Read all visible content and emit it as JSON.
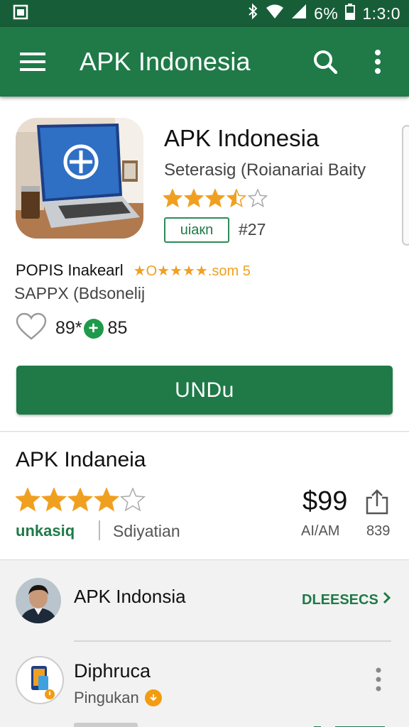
{
  "status_bar": {
    "battery": "6%",
    "time": "1:3:0"
  },
  "app_bar": {
    "title": "APK Indonesia",
    "icons": [
      "menu-icon",
      "search-icon",
      "more-vert-icon"
    ]
  },
  "app_card": {
    "name": "APK Indonesia",
    "subtitle": "Seterasig (Roianariai Baity",
    "rating_stars": 3.5,
    "tag": "uiaкn",
    "rank": "#27",
    "developer_line": "POPIS Inakeаrl",
    "developer_rating_text": "★O★★★★.som 5",
    "developer_sub": "SAPPX (Bdsonelij",
    "likes": "89*",
    "plus_count": "85",
    "install_label": "UNDu"
  },
  "details_card": {
    "title": "APK Indaneia",
    "rating_stars": 4,
    "category": "unkasiq",
    "subcategory": "Sdiyatian",
    "price": "$99",
    "time": "AI/AM",
    "count": "839"
  },
  "review_section": {
    "reviewer_name": "APK Indonsia",
    "link_label": "DLEESECS",
    "item_title": "Diphruca",
    "item_subtitle": "Pingukan"
  },
  "colors": {
    "primary": "#1f7a48",
    "primary_dark": "#175e38",
    "star": "#f0a020"
  }
}
